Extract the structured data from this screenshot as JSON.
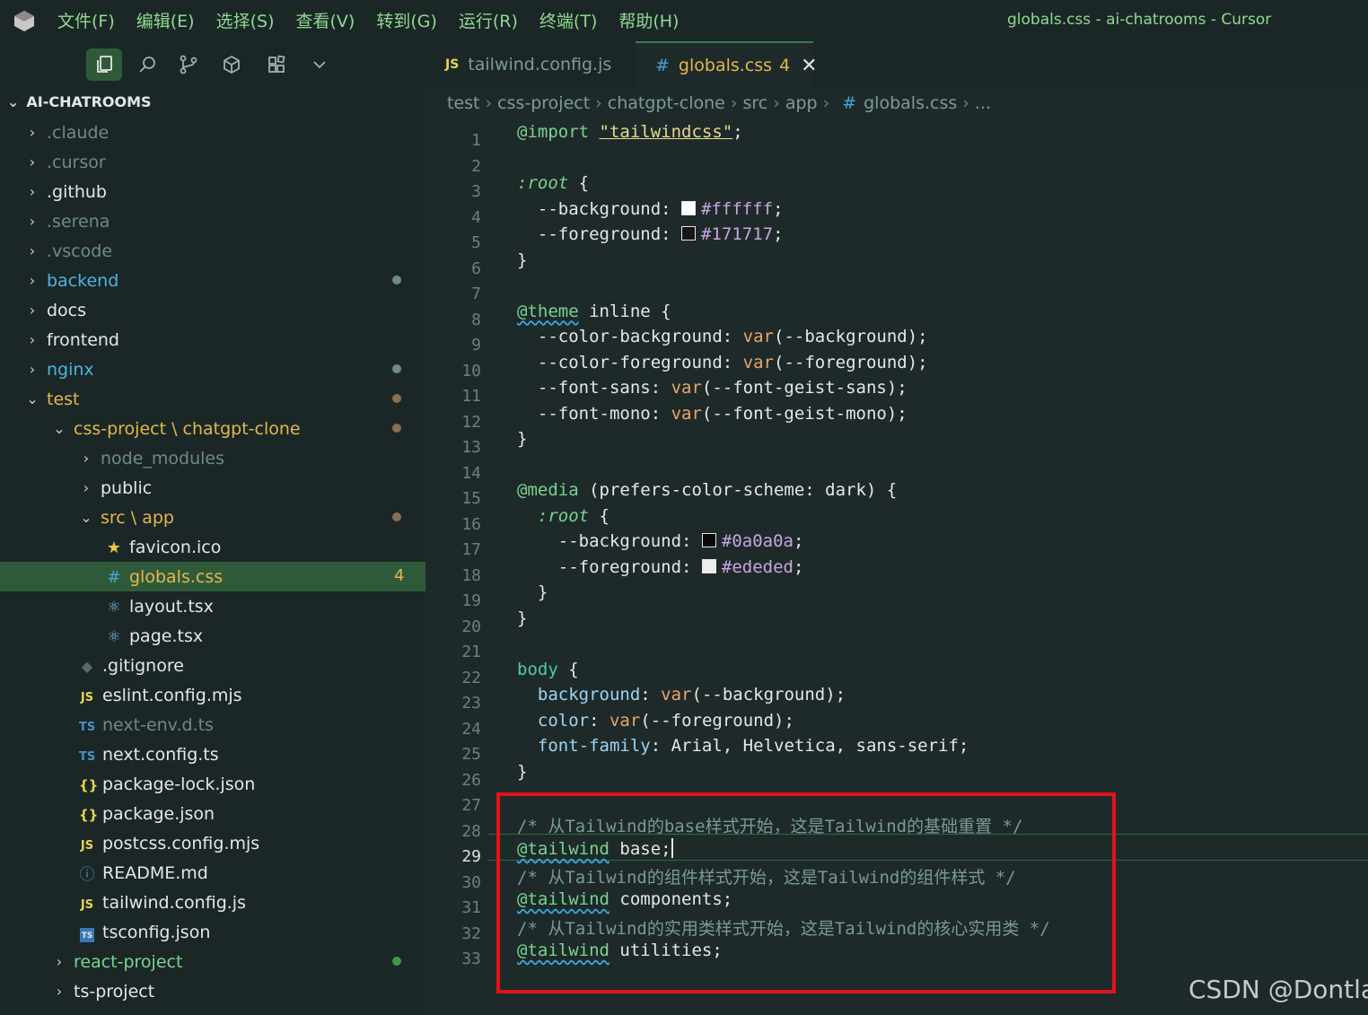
{
  "menu": [
    "文件(F)",
    "编辑(E)",
    "选择(S)",
    "查看(V)",
    "转到(G)",
    "运行(R)",
    "终端(T)",
    "帮助(H)"
  ],
  "window_title": "globals.css - ai-chatrooms - Cursor",
  "tabs": [
    {
      "badge": "JS",
      "label": "tailwind.config.js"
    },
    {
      "badge": "#",
      "label": "globals.css",
      "count": "4",
      "close": "✕"
    }
  ],
  "breadcrumb": [
    "test",
    "css-project",
    "chatgpt-clone",
    "src",
    "app",
    "#",
    "globals.css",
    "..."
  ],
  "explorer": {
    "title": "AI-CHATROOMS",
    "items": [
      {
        "label": ".claude",
        "color": "#6e8a8a"
      },
      {
        "label": ".cursor",
        "color": "#6e8a8a"
      },
      {
        "label": ".github",
        "color": "#e6e6e6"
      },
      {
        "label": ".serena",
        "color": "#6e8a8a"
      },
      {
        "label": ".vscode",
        "color": "#6e8a8a"
      },
      {
        "label": "backend",
        "color": "#4fb3e0"
      },
      {
        "label": "docs",
        "color": "#e6e6e6"
      },
      {
        "label": "frontend",
        "color": "#e6e6e6"
      },
      {
        "label": "nginx",
        "color": "#4fb3e0"
      },
      {
        "label": "test",
        "color": "#e2b84a"
      },
      {
        "label": "css-project \\ chatgpt-clone",
        "color": "#e2b84a"
      },
      {
        "label": "node_modules",
        "color": "#6e8a8a"
      },
      {
        "label": "public",
        "color": "#e6e6e6"
      },
      {
        "label": "src \\ app",
        "color": "#e2b84a"
      },
      {
        "label": "favicon.ico",
        "color": "#e6e6e6"
      },
      {
        "label": "globals.css",
        "color": "#e2b84a",
        "count": "4"
      },
      {
        "label": "layout.tsx",
        "color": "#e6e6e6"
      },
      {
        "label": "page.tsx",
        "color": "#e6e6e6"
      },
      {
        "label": ".gitignore",
        "color": "#e6e6e6"
      },
      {
        "label": "eslint.config.mjs",
        "color": "#e6e6e6"
      },
      {
        "label": "next-env.d.ts",
        "color": "#6e8a8a"
      },
      {
        "label": "next.config.ts",
        "color": "#e6e6e6"
      },
      {
        "label": "package-lock.json",
        "color": "#e6e6e6"
      },
      {
        "label": "package.json",
        "color": "#e6e6e6"
      },
      {
        "label": "postcss.config.mjs",
        "color": "#e6e6e6"
      },
      {
        "label": "README.md",
        "color": "#e6e6e6"
      },
      {
        "label": "tailwind.config.js",
        "color": "#e6e6e6"
      },
      {
        "label": "tsconfig.json",
        "color": "#e6e6e6"
      },
      {
        "label": "react-project",
        "color": "#7ad38f"
      },
      {
        "label": "ts-project",
        "color": "#e6e6e6"
      }
    ]
  },
  "code_lines": [
    "@import \"tailwindcss\";",
    "",
    ":root {",
    "  --background: #ffffff;",
    "  --foreground: #171717;",
    "}",
    "",
    "@theme inline {",
    "  --color-background: var(--background);",
    "  --color-foreground: var(--foreground);",
    "  --font-sans: var(--font-geist-sans);",
    "  --font-mono: var(--font-geist-mono);",
    "}",
    "",
    "@media (prefers-color-scheme: dark) {",
    "  :root {",
    "    --background: #0a0a0a;",
    "    --foreground: #ededed;",
    "  }",
    "}",
    "",
    "body {",
    "  background: var(--background);",
    "  color: var(--foreground);",
    "  font-family: Arial, Helvetica, sans-serif;",
    "}",
    "",
    "/* 从Tailwind的base样式开始，这是Tailwind的基础重置 */",
    "@tailwind base;",
    "/* 从Tailwind的组件样式开始，这是Tailwind的组件样式 */",
    "@tailwind components;",
    "/* 从Tailwind的实用类样式开始，这是Tailwind的核心实用类 */",
    "@tailwind utilities;"
  ],
  "active_line": "29",
  "watermark": "CSDN @Dontla"
}
